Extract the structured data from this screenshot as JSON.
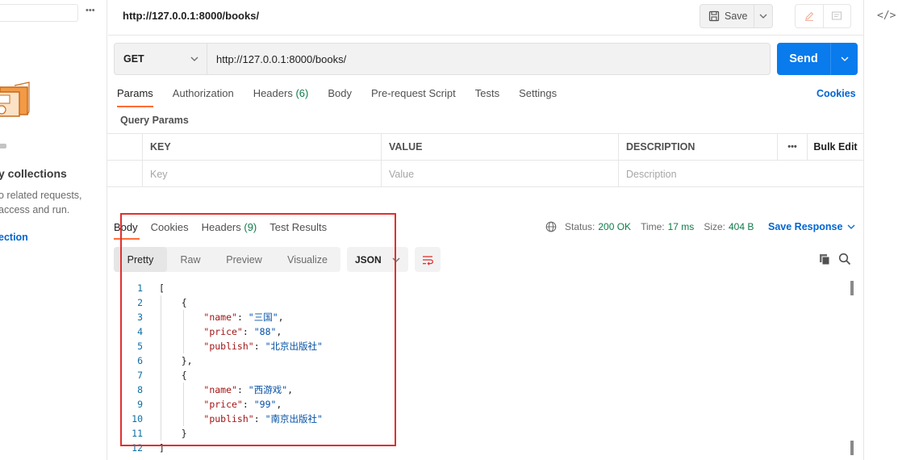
{
  "sidebar": {
    "more_label": "•••",
    "empty_title": "y collections",
    "empty_desc_line1": "o related requests,",
    "empty_desc_line2": " access and run.",
    "create_link": "ection"
  },
  "topbar": {
    "tab_url": "http://127.0.0.1:8000/books/",
    "save_label": "Save"
  },
  "request": {
    "method": "GET",
    "url": "http://127.0.0.1:8000/books/",
    "send_label": "Send",
    "tabs": [
      {
        "label": "Params"
      },
      {
        "label": "Authorization"
      },
      {
        "label": "Headers",
        "count": "(6)"
      },
      {
        "label": "Body"
      },
      {
        "label": "Pre-request Script"
      },
      {
        "label": "Tests"
      },
      {
        "label": "Settings"
      }
    ],
    "cookies_label": "Cookies",
    "query_params_label": "Query Params",
    "params_table": {
      "headers": [
        "KEY",
        "VALUE",
        "DESCRIPTION",
        "•••",
        "Bulk Edit"
      ],
      "placeholders": [
        "Key",
        "Value",
        "Description"
      ]
    }
  },
  "response": {
    "tabs": [
      {
        "label": "Body"
      },
      {
        "label": "Cookies"
      },
      {
        "label": "Headers",
        "count": "(9)"
      },
      {
        "label": "Test Results"
      }
    ],
    "status_label": "Status:",
    "status_value": "200 OK",
    "time_label": "Time:",
    "time_value": "17 ms",
    "size_label": "Size:",
    "size_value": "404 B",
    "save_response_label": "Save Response",
    "view_tabs": [
      "Pretty",
      "Raw",
      "Preview",
      "Visualize"
    ],
    "format": "JSON",
    "code_lines": [
      {
        "n": "1",
        "text": "["
      },
      {
        "n": "2",
        "text": "    {"
      },
      {
        "n": "3",
        "key": "\"name\"",
        "val": "\"三国\"",
        "indent": "        ",
        "trail": ","
      },
      {
        "n": "4",
        "key": "\"price\"",
        "val": "\"88\"",
        "indent": "        ",
        "trail": ","
      },
      {
        "n": "5",
        "key": "\"publish\"",
        "val": "\"北京出版社\"",
        "indent": "        ",
        "trail": ""
      },
      {
        "n": "6",
        "text": "    },"
      },
      {
        "n": "7",
        "text": "    {"
      },
      {
        "n": "8",
        "key": "\"name\"",
        "val": "\"西游戏\"",
        "indent": "        ",
        "trail": ","
      },
      {
        "n": "9",
        "key": "\"price\"",
        "val": "\"99\"",
        "indent": "        ",
        "trail": ","
      },
      {
        "n": "10",
        "key": "\"publish\"",
        "val": "\"南京出版社\"",
        "indent": "        ",
        "trail": ""
      },
      {
        "n": "11",
        "text": "    }"
      },
      {
        "n": "12",
        "text": "]"
      }
    ]
  },
  "colors": {
    "accent_orange": "#ff6c37",
    "send_blue": "#097bed",
    "link_blue": "#0265d2",
    "status_green": "#0f7b4a",
    "highlight_red": "#e0302f"
  },
  "icons": [
    "save-icon",
    "chevron-down-icon",
    "edit-icon",
    "comment-icon",
    "code-icon",
    "globe-icon",
    "wrap-icon",
    "copy-icon",
    "search-icon"
  ]
}
